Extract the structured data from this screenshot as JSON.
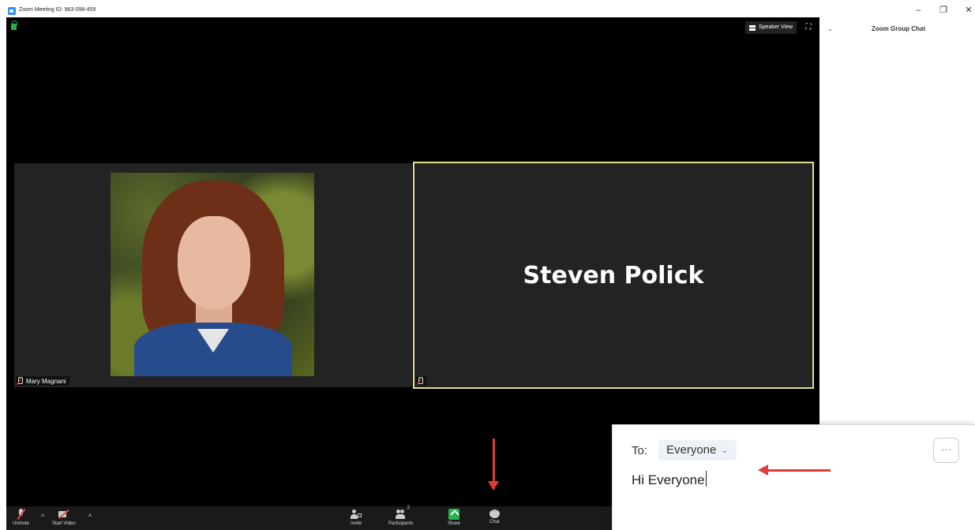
{
  "titlebar": {
    "title": "Zoom Meeting ID: 963-098-459",
    "icons": [
      "zoom-logo-icon",
      "minimize-icon",
      "restore-icon",
      "close-icon"
    ],
    "minimize": "–",
    "restore": "❐",
    "close": "✕"
  },
  "video": {
    "view_button_label": "Speaker View",
    "fullscreen_icon": "⛶",
    "tiles": [
      {
        "name": "Mary Magnani",
        "has_video": true,
        "muted": true
      },
      {
        "name": "Steven Polick",
        "has_video": false,
        "muted": true,
        "active_speaker": true
      }
    ],
    "active_border_color": "#e3df8e"
  },
  "toolbar": {
    "unmute_label": "Unmute",
    "start_video_label": "Start Video",
    "invite_label": "Invite",
    "participants_label": "Participants",
    "participants_count": "2",
    "share_label": "Share",
    "chat_label": "Chat",
    "caret": "^",
    "share_color": "#2bb24c"
  },
  "chat": {
    "collapse_icon": "⌄",
    "title": "Zoom Group Chat",
    "to_label": "To:",
    "recipient": "Everyone",
    "recipient_chevron": "⌄",
    "more_label": "···",
    "message_draft": "Hi Everyone"
  },
  "annotations": {
    "arrow_color": "#e23b3b"
  }
}
